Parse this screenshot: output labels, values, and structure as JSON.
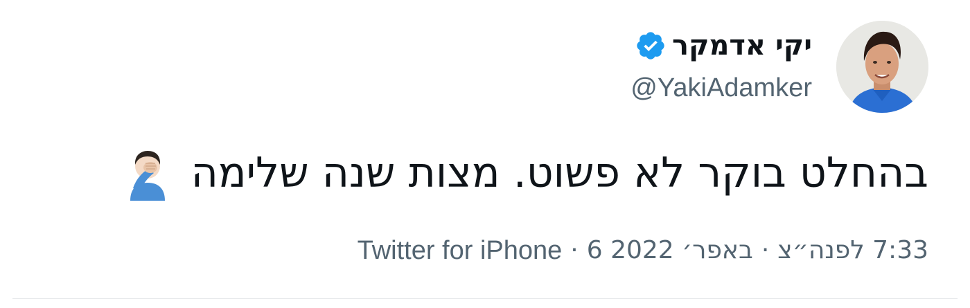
{
  "author": {
    "display_name": "יקי אדמקר",
    "handle": "@YakiAdamker",
    "verified": true
  },
  "tweet": {
    "text": "בהחלט בוקר לא פשוט. מצות שנה שלימה",
    "emoji": "person-facepalming"
  },
  "meta": {
    "time": "7:33 לפנה״צ",
    "date": "6 באפר׳ 2022",
    "source": "Twitter for iPhone",
    "separator": "·"
  },
  "colors": {
    "text_primary": "#0f1419",
    "text_secondary": "#536471",
    "verified_blue": "#1d9bf0"
  },
  "icons": {
    "verified": "verified-badge-icon",
    "emoji": "facepalm-emoji-icon",
    "avatar": "profile-avatar"
  }
}
